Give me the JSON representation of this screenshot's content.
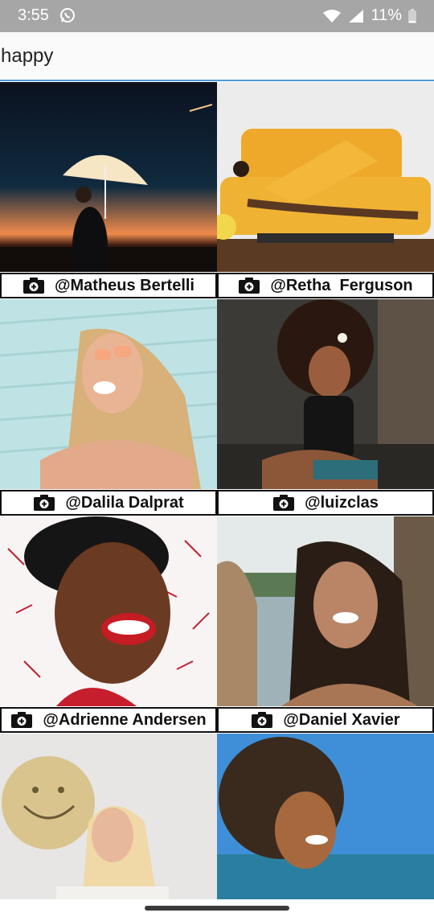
{
  "status_bar": {
    "time": "3:55",
    "battery": "11%",
    "icons": [
      "whatsapp-icon",
      "wifi-icon",
      "signal-icon",
      "battery-icon"
    ]
  },
  "search": {
    "value": "happy",
    "placeholder": ""
  },
  "photos": [
    {
      "author": "@Matheus Bertelli"
    },
    {
      "author": "@Retha  Ferguson"
    },
    {
      "author": "@Dalila Dalprat"
    },
    {
      "author": "@luizclas"
    },
    {
      "author": "@Adrienne Andersen"
    },
    {
      "author": "@Daniel Xavier"
    },
    {
      "author": ""
    },
    {
      "author": ""
    }
  ],
  "colors": {
    "status_bar": "#a6a6a6",
    "accent": "#4f9bd6",
    "caption_border": "#111111"
  }
}
